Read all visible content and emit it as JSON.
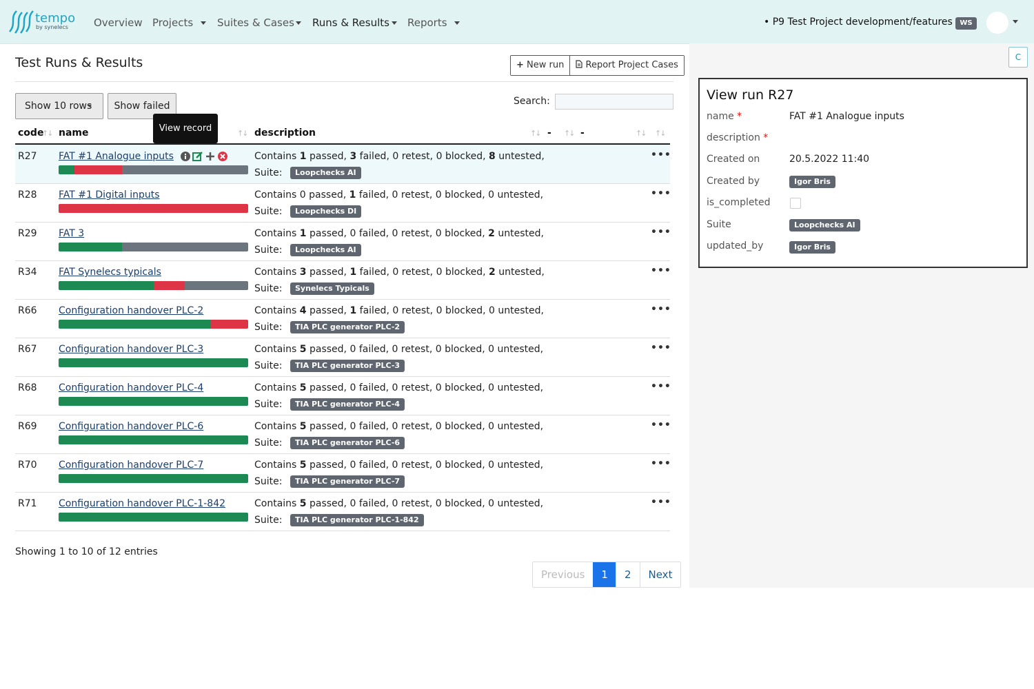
{
  "colors": {
    "passed": "#1e8a53",
    "failed": "#dd3545",
    "untested": "#6c757d",
    "accent": "#1a73e8",
    "nav_bg": "#e2f3f4"
  },
  "nav": {
    "logo_text": "tempo",
    "logo_sub": "by synelecs",
    "items": [
      "Overview",
      "Projects",
      "Suites & Cases",
      "Runs & Results",
      "Reports"
    ],
    "project": "P9 Test Project development/features",
    "project_badge": "WS"
  },
  "page": {
    "title": "Test Runs & Results",
    "new_run": "New run",
    "report": "Report Project Cases",
    "rows_button": "Show 10 rows",
    "show_failed": "Show failed",
    "search_label": "Search:",
    "search_value": "",
    "tooltip": "View record"
  },
  "table": {
    "headers": {
      "code": "code",
      "name": "name",
      "description": "description",
      "dash1": "-",
      "dash2": "-"
    },
    "suite_label": "Suite:",
    "rows": [
      {
        "code": "R27",
        "name": "FAT #1 Analogue inputs",
        "passed": "1",
        "failed": "3",
        "retest": "0",
        "blocked": "0",
        "untested": "8",
        "suite": "Loopchecks AI",
        "bar": [
          1,
          3,
          8
        ]
      },
      {
        "code": "R28",
        "name": "FAT #1 Digital inputs",
        "passed": "0",
        "failed": "1",
        "retest": "0",
        "blocked": "0",
        "untested": "0",
        "suite": "Loopchecks DI",
        "bar": [
          0,
          1,
          0
        ]
      },
      {
        "code": "R29",
        "name": "FAT 3",
        "passed": "1",
        "failed": "0",
        "retest": "0",
        "blocked": "0",
        "untested": "2",
        "suite": "Loopchecks AI",
        "bar": [
          1,
          0,
          2
        ]
      },
      {
        "code": "R34",
        "name": "FAT Synelecs typicals",
        "passed": "3",
        "failed": "1",
        "retest": "0",
        "blocked": "0",
        "untested": "2",
        "suite": "Synelecs Typicals",
        "bar": [
          3,
          1,
          2
        ]
      },
      {
        "code": "R66",
        "name": "Configuration handover PLC-2",
        "passed": "4",
        "failed": "1",
        "retest": "0",
        "blocked": "0",
        "untested": "0",
        "suite": "TIA PLC generator PLC-2",
        "bar": [
          4,
          1,
          0
        ]
      },
      {
        "code": "R67",
        "name": "Configuration handover PLC-3",
        "passed": "5",
        "failed": "0",
        "retest": "0",
        "blocked": "0",
        "untested": "0",
        "suite": "TIA PLC generator PLC-3",
        "bar": [
          5,
          0,
          0
        ]
      },
      {
        "code": "R68",
        "name": "Configuration handover PLC-4",
        "passed": "5",
        "failed": "0",
        "retest": "0",
        "blocked": "0",
        "untested": "0",
        "suite": "TIA PLC generator PLC-4",
        "bar": [
          5,
          0,
          0
        ]
      },
      {
        "code": "R69",
        "name": "Configuration handover PLC-6",
        "passed": "5",
        "failed": "0",
        "retest": "0",
        "blocked": "0",
        "untested": "0",
        "suite": "TIA PLC generator PLC-6",
        "bar": [
          5,
          0,
          0
        ]
      },
      {
        "code": "R70",
        "name": "Configuration handover PLC-7",
        "passed": "5",
        "failed": "0",
        "retest": "0",
        "blocked": "0",
        "untested": "0",
        "suite": "TIA PLC generator PLC-7",
        "bar": [
          5,
          0,
          0
        ]
      },
      {
        "code": "R71",
        "name": "Configuration handover PLC-1-842",
        "passed": "5",
        "failed": "0",
        "retest": "0",
        "blocked": "0",
        "untested": "0",
        "suite": "TIA PLC generator PLC-1-842",
        "bar": [
          5,
          0,
          0
        ]
      }
    ]
  },
  "footer": {
    "showing": "Showing 1 to 10 of 12 entries",
    "previous": "Previous",
    "page1": "1",
    "page2": "2",
    "next": "Next"
  },
  "detail": {
    "c_button": "C",
    "title": "View run R27",
    "name_label": "name",
    "name_value": "FAT #1 Analogue inputs",
    "description_label": "description",
    "created_on_label": "Created on",
    "created_on_value": "20.5.2022 11:40",
    "created_by_label": "Created by",
    "created_by_value": "Igor Bris",
    "is_completed_label": "is_completed",
    "suite_label": "Suite",
    "suite_value": "Loopchecks AI",
    "updated_by_label": "updated_by",
    "updated_by_value": "Igor Bris",
    "required_mark": "*"
  }
}
